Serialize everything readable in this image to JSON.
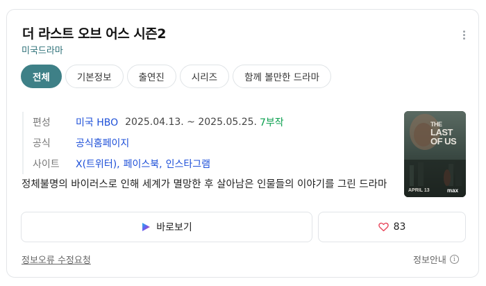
{
  "header": {
    "title": "더 라스트 오브 어스 시즌2",
    "subtitle": "미국드라마"
  },
  "tabs": [
    {
      "label": "전체",
      "active": true
    },
    {
      "label": "기본정보",
      "active": false
    },
    {
      "label": "출연진",
      "active": false
    },
    {
      "label": "시리즈",
      "active": false
    },
    {
      "label": "함께 볼만한 드라마",
      "active": false
    }
  ],
  "info": {
    "broadcast": {
      "label": "편성",
      "network": "미국 HBO",
      "dates": "2025.04.13. ~ 2025.05.25.",
      "episodes": "7부작"
    },
    "official": {
      "label": "공식",
      "link": "공식홈페이지"
    },
    "sites": {
      "label": "사이트",
      "links": [
        "X(트위터),",
        "페이스북,",
        "인스타그램"
      ]
    }
  },
  "description": "정체불명의 바이러스로 인해 세계가 멸망한 후 살아남은 인물들의 이야기를 그린 드라마",
  "poster": {
    "title_line1": "THE",
    "title_line2": "LAST",
    "title_line3": "OF US",
    "date_text": "APRIL 13",
    "brand": "max"
  },
  "actions": {
    "watch_label": "바로보기",
    "like_count": "83"
  },
  "footer": {
    "report_label": "정보오류 수정요청",
    "info_label": "정보안내",
    "info_icon_glyph": "i"
  },
  "colors": {
    "accent": "#3e8087",
    "link": "#1d4fd8",
    "episodes": "#0a9f4e",
    "subtitle": "#2b6f77"
  }
}
